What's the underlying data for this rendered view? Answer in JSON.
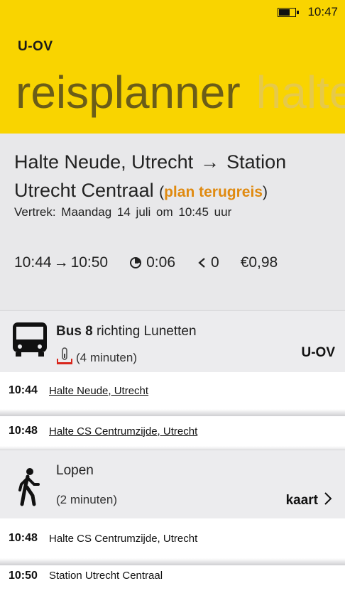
{
  "status_bar": {
    "time": "10:47"
  },
  "app": {
    "title": "U-OV"
  },
  "pivot": {
    "active": "reisplanner",
    "next": "halte"
  },
  "summary": {
    "from": "Halte Neude, Utrecht",
    "to_line1": "Station",
    "to_line2": "Utrecht Centraal",
    "return_link": "plan terugreis",
    "departure": "Vertrek:  Maandag  14  juli om  10:45 uur",
    "times": "10:44",
    "arrive": "10:50",
    "duration": "0:06",
    "transfers": "0",
    "price": "€0,98"
  },
  "legs": {
    "bus": {
      "line": "Bus 8",
      "direction": "richting Lunetten",
      "duration": "(4 minuten)",
      "operator": "U-OV",
      "icon": "bus-icon"
    },
    "walk": {
      "title": "Lopen",
      "duration": "(2 minuten)",
      "map_label": "kaart",
      "icon": "walk-icon"
    }
  },
  "stops": [
    {
      "time": "10:44",
      "name": "Halte Neude, Utrecht"
    },
    {
      "time": "10:48",
      "name": "Halte CS Centrumzijde, Utrecht"
    },
    {
      "time": "10:48",
      "name": "Halte CS Centrumzijde, Utrecht"
    },
    {
      "time": "10:50",
      "name": "Station Utrecht Centraal"
    }
  ],
  "colors": {
    "accent": "#f9d400",
    "link": "#e08a10",
    "pivot_active": "#6b5d18"
  }
}
